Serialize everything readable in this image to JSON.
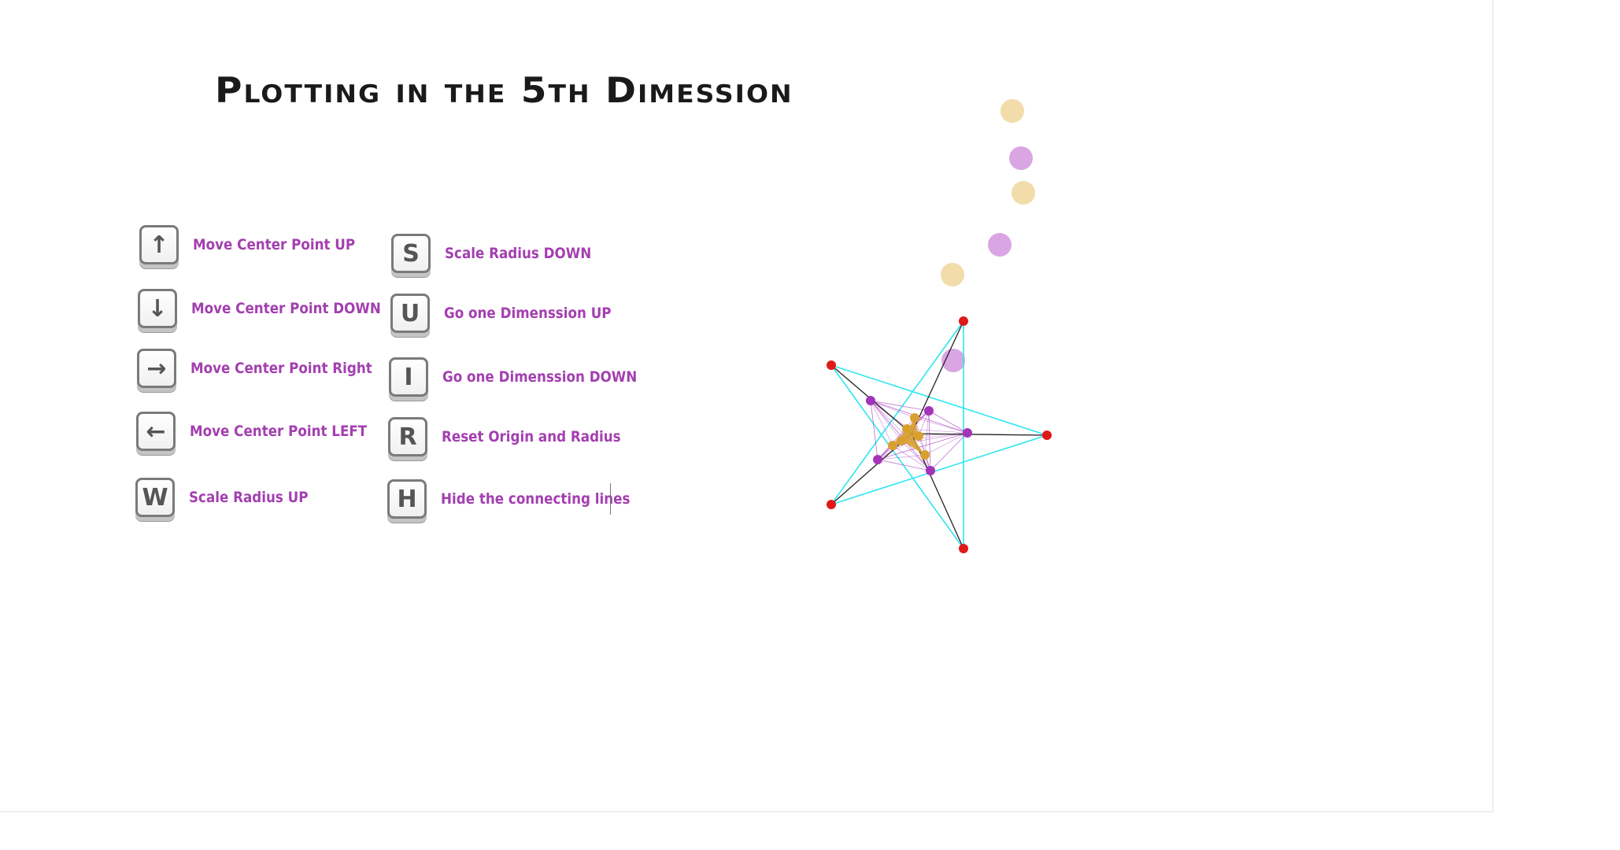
{
  "title": "Plotting in the 5th Dimession",
  "controls": [
    {
      "key": "↑",
      "label": "Move Center Point UP",
      "icon": "arrow-up-icon"
    },
    {
      "key": "↓",
      "label": "Move Center Point DOWN",
      "icon": "arrow-down-icon"
    },
    {
      "key": "→",
      "label": "Move Center Point Right",
      "icon": "arrow-right-icon"
    },
    {
      "key": "←",
      "label": "Move Center Point LEFT",
      "icon": "arrow-left-icon"
    },
    {
      "key": "W",
      "label": "Scale Radius UP",
      "icon": "key-w-icon"
    },
    {
      "key": "S",
      "label": "Scale Radius DOWN",
      "icon": "key-s-icon"
    },
    {
      "key": "U",
      "label": "Go one Dimenssion UP",
      "icon": "key-u-icon"
    },
    {
      "key": "I",
      "label": "Go one Dimenssion DOWN",
      "icon": "key-i-icon"
    },
    {
      "key": "R",
      "label": "Reset Origin and Radius",
      "icon": "key-r-icon"
    },
    {
      "key": "H",
      "label": "Hide the connecting lines",
      "icon": "key-h-icon"
    }
  ],
  "colors": {
    "label": "#a33fb0",
    "vertex": "#e01818",
    "spoke": "#222222",
    "star_lines": "#2ee6f0",
    "inner_point": "#a333b8",
    "core_point": "#d9a030",
    "bubble_tan": "#f2dcaa",
    "bubble_lilac": "#d9a6e3"
  }
}
